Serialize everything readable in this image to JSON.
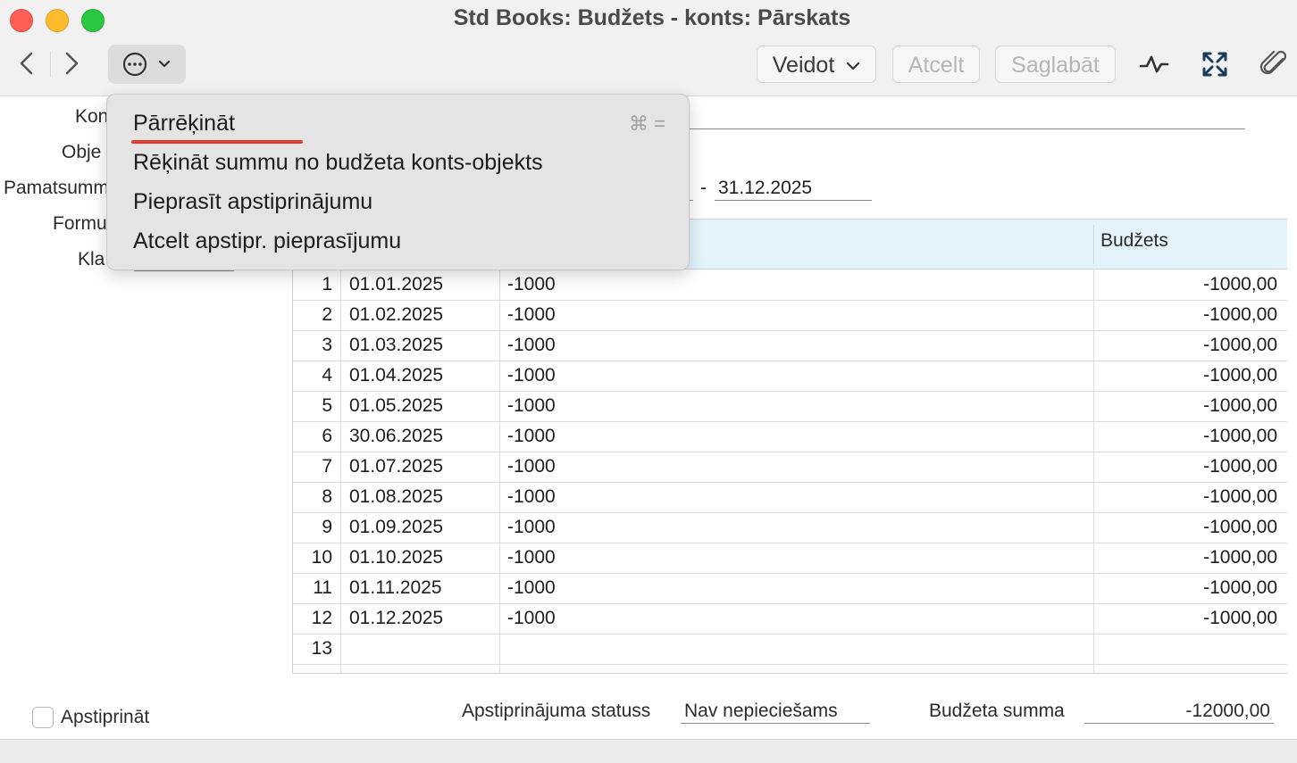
{
  "window": {
    "title": "Std Books: Budžets - konts: Pārskats"
  },
  "toolbar": {
    "veidot_label": "Veidot",
    "atcelt_label": "Atcelt",
    "saglabat_label": "Saglabāt"
  },
  "form": {
    "labels": [
      "Kon",
      "Obje",
      "Pamatsumm",
      "Formu",
      "Kla"
    ],
    "date_sep": "-",
    "date_to": "31.12.2025"
  },
  "grid": {
    "header_budzets": "Budžets",
    "rows": [
      {
        "num": "1",
        "date": "01.01.2025",
        "value": "-1000",
        "budget": "-1000,00"
      },
      {
        "num": "2",
        "date": "01.02.2025",
        "value": "-1000",
        "budget": "-1000,00"
      },
      {
        "num": "3",
        "date": "01.03.2025",
        "value": "-1000",
        "budget": "-1000,00"
      },
      {
        "num": "4",
        "date": "01.04.2025",
        "value": "-1000",
        "budget": "-1000,00"
      },
      {
        "num": "5",
        "date": "01.05.2025",
        "value": "-1000",
        "budget": "-1000,00"
      },
      {
        "num": "6",
        "date": "30.06.2025",
        "value": "-1000",
        "budget": "-1000,00"
      },
      {
        "num": "7",
        "date": "01.07.2025",
        "value": "-1000",
        "budget": "-1000,00"
      },
      {
        "num": "8",
        "date": "01.08.2025",
        "value": "-1000",
        "budget": "-1000,00"
      },
      {
        "num": "9",
        "date": "01.09.2025",
        "value": "-1000",
        "budget": "-1000,00"
      },
      {
        "num": "10",
        "date": "01.10.2025",
        "value": "-1000",
        "budget": "-1000,00"
      },
      {
        "num": "11",
        "date": "01.11.2025",
        "value": "-1000",
        "budget": "-1000,00"
      },
      {
        "num": "12",
        "date": "01.12.2025",
        "value": "-1000",
        "budget": "-1000,00"
      },
      {
        "num": "13",
        "date": "",
        "value": "",
        "budget": ""
      }
    ]
  },
  "menu": {
    "items": [
      {
        "label": "Pārrēķināt",
        "shortcut": "⌘ ="
      },
      {
        "label": "Rēķināt summu no budžeta konts-objekts"
      },
      {
        "label": "Pieprasīt apstiprinājumu"
      },
      {
        "label": "Atcelt apstipr. pieprasījumu"
      }
    ],
    "highlight_color": "#e5392c"
  },
  "footer": {
    "approve_label": "Apstiprināt",
    "approve_checked": false,
    "status_label": "Apstiprinājuma statuss",
    "status_value": "Nav nepieciešams",
    "sum_label": "Budžeta summa",
    "sum_value": "-12000,00"
  }
}
